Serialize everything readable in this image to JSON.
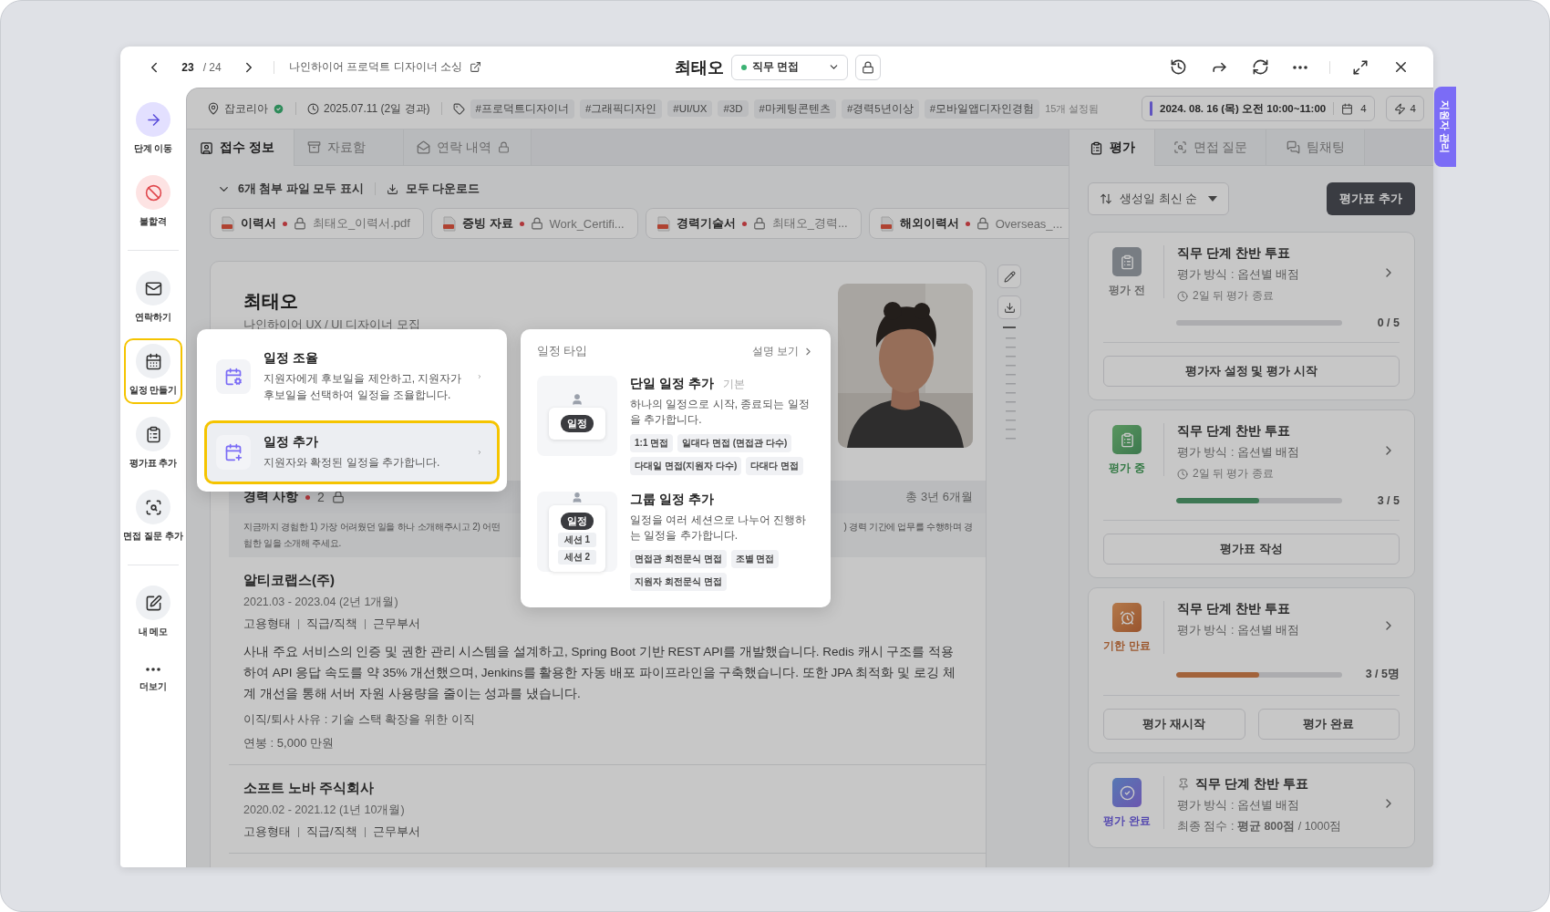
{
  "top_bar": {
    "page_current": "23",
    "page_total": "/ 24",
    "project": "나인하이어 프로덕트 디자이너 소싱",
    "candidate": "최태오",
    "stage": "직무 면접"
  },
  "side_tab": "지원자 관리",
  "sidebar": {
    "groups": [
      {
        "items": [
          {
            "label": "단계 이동",
            "kind": "primary",
            "highlighted": false
          },
          {
            "label": "불합격",
            "kind": "danger",
            "highlighted": false
          }
        ]
      },
      {
        "items": [
          {
            "label": "연락하기",
            "kind": "default",
            "highlighted": false
          },
          {
            "label": "일정 만들기",
            "kind": "default",
            "highlighted": true
          },
          {
            "label": "평가표 추가",
            "kind": "default",
            "highlighted": false
          },
          {
            "label": "면접 질문 추가",
            "kind": "default",
            "highlighted": false
          }
        ]
      },
      {
        "items": [
          {
            "label": "내 메모",
            "kind": "default",
            "highlighted": false
          },
          {
            "label": "더보기",
            "kind": "plain",
            "highlighted": false
          }
        ]
      }
    ]
  },
  "info_bar": {
    "source": "잡코리아",
    "verified": true,
    "applied": "2025.07.11 (2일 경과)",
    "tags": [
      "#프로덕트디자이너",
      "#그래픽디자인",
      "#UI/UX",
      "#3D",
      "#마케팅콘텐츠",
      "#경력5년이상",
      "#모바일앱디자인경험"
    ],
    "tags_more": "15개 설정됨",
    "schedule": "2024. 08. 16 (목) 오전 10:00~11:00",
    "schedule_count": "4",
    "action_count": "4"
  },
  "left_tabs": [
    {
      "label": "접수 정보",
      "selected": true,
      "locked": false
    },
    {
      "label": "자료함",
      "selected": false,
      "locked": false
    },
    {
      "label": "연락 내역",
      "selected": false,
      "locked": true
    }
  ],
  "files": {
    "toggle": "6개 첨부 파일 모두 표시",
    "download_all": "모두 다운로드",
    "items": [
      {
        "type": "이력서",
        "required": true,
        "locked": true,
        "file": "최태오_이력서.pdf"
      },
      {
        "type": "증빙 자료",
        "required": true,
        "locked": true,
        "file": "Work_Certifi..."
      },
      {
        "type": "경력기술서",
        "required": true,
        "locked": true,
        "file": "최태오_경력..."
      },
      {
        "type": "해외이력서",
        "required": true,
        "locked": true,
        "file": "Overseas_..."
      }
    ]
  },
  "resume": {
    "name": "최태오",
    "subtitle": "나인하이어 UX / UI 디자이너 모집",
    "career": {
      "title": "경력 사항",
      "required": true,
      "count": "2",
      "locked": true,
      "total": "총 3년 6개월",
      "prompt": [
        "지금까지 경험한 1) 가장 어려웠던 일을 하나 소개해주시고 2) 어떤",
        ") 경력 기간에 업무를 수행하며 경",
        "험한 일을 소개해 주세요."
      ],
      "jobs": [
        {
          "company": "알티코랩스(주)",
          "period": "2021.03 - 2023.04 (2년 1개월)",
          "meta": [
            "고용형태",
            "직급/직책",
            "근무부서"
          ],
          "description": "사내 주요 서비스의 인증 및 권한 관리 시스템을 설계하고, Spring Boot 기반 REST API를 개발했습니다. Redis 캐시 구조를 적용하여 API 응답 속도를 약 35% 개선했으며, Jenkins를 활용한 자동 배포 파이프라인을 구축했습니다. 또한 JPA 최적화 및 로깅 체계 개선을 통해 서버 자원 사용량을 줄이는 성과를 냈습니다.",
          "reason": "이직/퇴사 사유 : 기술 스택 확장을 위한 이직",
          "salary": "연봉 : 5,000 만원"
        },
        {
          "company": "소프트 노바 주식회사",
          "period": "2020.02 - 2021.12 (1년 10개월)",
          "meta": [
            "고용형태",
            "직급/직책",
            "근무부서"
          ]
        }
      ]
    }
  },
  "right_tabs": [
    {
      "label": "평가",
      "selected": true
    },
    {
      "label": "면접 질문",
      "selected": false
    },
    {
      "label": "팀채팅",
      "selected": false
    }
  ],
  "sort": "생성일 최신 순",
  "add_button": "평가표 추가",
  "evaluations": [
    {
      "status": "평가 전",
      "kind": "before",
      "title": "직무 단계 찬반 투표",
      "method": "평가 방식 : 옵션별 배점",
      "due": "2일 뒤 평가 종료",
      "level": 0,
      "count": "0 / 5",
      "actions": [
        "평가자 설정 및 평가 시작"
      ]
    },
    {
      "status": "평가 중",
      "kind": "ongoing",
      "title": "직무 단계 찬반 투표",
      "method": "평가 방식 : 옵션별 배점",
      "due": "2일 뒤 평가 종료",
      "level": 0.5,
      "count": "3 / 5",
      "actions": [
        "평가표 작성"
      ]
    },
    {
      "status": "기한 만료",
      "kind": "expired",
      "title": "직무 단계 찬반 투표",
      "method": "평가 방식 : 옵션별 배점",
      "level": 0.5,
      "count": "3 / 5명",
      "actions": [
        "평가 재시작",
        "평가 완료"
      ]
    },
    {
      "status": "평가 완료",
      "kind": "done",
      "pinned": true,
      "title": "직무 단계 찬반 투표",
      "method": "평가 방식 : 옵션별 배점",
      "score": "최종 점수 : **평균 800점** / 1000점"
    }
  ],
  "schedule_menu": [
    {
      "title": "일정 조율",
      "description": "지원자에게 후보일을 제안하고, 지원자가 후보일을 선택하여 일정을 조율합니다.",
      "selected": false
    },
    {
      "title": "일정 추가",
      "description": "지원자와 확정된 일정을 추가합니다.",
      "selected": true
    }
  ],
  "schedule_types": {
    "title": "일정 타입",
    "link": "설명 보기",
    "options": [
      {
        "title": "단일 일정 추가",
        "badge": "기본",
        "description": "하나의 일정으로 시작, 종료되는 일정을 추가합니다.",
        "tags": [
          "1:1 면접",
          "일대다 면접 (면접관 다수)",
          "다대일 면접(지원자 다수)",
          "다대다 면접"
        ],
        "card_label": "일정"
      },
      {
        "title": "그룹 일정 추가",
        "description": "일정을 여러 세션으로 나누어 진행하는 일정을 추가합니다.",
        "tags": [
          "면접관 회전문식 면접",
          "조별 면접",
          "지원자 회전문식 면접"
        ],
        "card_label": "일정",
        "sessions": [
          "세션 1",
          "세션 2"
        ]
      }
    ]
  }
}
